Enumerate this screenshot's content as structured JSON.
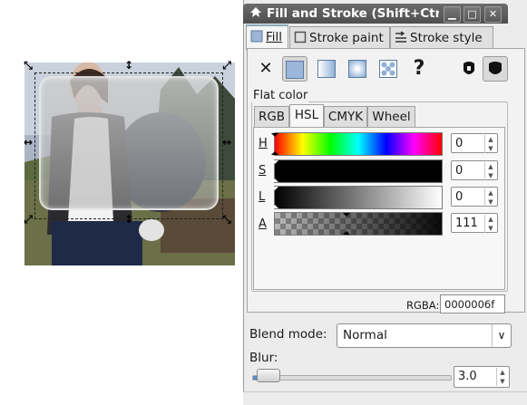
{
  "window": {
    "title": "Fill and Stroke (Shift+Ctrl+F)",
    "controls": {
      "minimize": "▁",
      "maximize": "□",
      "close": "✕"
    }
  },
  "tabs": [
    {
      "label": "Fill",
      "mnemonic": "F",
      "active": true
    },
    {
      "label": "Stroke paint",
      "mnemonic": "p",
      "active": false
    },
    {
      "label": "Stroke style",
      "mnemonic": "y",
      "active": false
    }
  ],
  "paint_types": [
    {
      "name": "no-paint",
      "icon": "x-icon",
      "glyph": "✕"
    },
    {
      "name": "flat-color",
      "icon": "flat-color-icon",
      "selected": true
    },
    {
      "name": "linear-gradient",
      "icon": "linear-gradient-icon"
    },
    {
      "name": "radial-gradient",
      "icon": "radial-gradient-icon"
    },
    {
      "name": "pattern",
      "icon": "pattern-icon"
    },
    {
      "name": "unset",
      "icon": "question-icon",
      "glyph": "?"
    }
  ],
  "fill_rules": [
    {
      "name": "evenodd",
      "icon": "fill-rule-evenodd-icon"
    },
    {
      "name": "nonzero",
      "icon": "fill-rule-nonzero-icon",
      "selected": true
    }
  ],
  "flat_color": {
    "label": "Flat color",
    "modes": [
      "RGB",
      "HSL",
      "CMYK",
      "Wheel"
    ],
    "active_mode": "HSL",
    "channels": [
      {
        "label": "H",
        "value": "0"
      },
      {
        "label": "S",
        "value": "0"
      },
      {
        "label": "L",
        "value": "0"
      },
      {
        "label": "A",
        "value": "111"
      }
    ],
    "rgba_label": "RGBA:",
    "rgba_value": "0000006f"
  },
  "blend": {
    "label": "Blend mode:",
    "value": "Normal"
  },
  "blur": {
    "label": "Blur:",
    "value": "3.0",
    "fraction": 0.03
  },
  "colors": {
    "accent": "#5b88c6",
    "titlebar": "#5a5a5a",
    "panel": "#ececec"
  }
}
